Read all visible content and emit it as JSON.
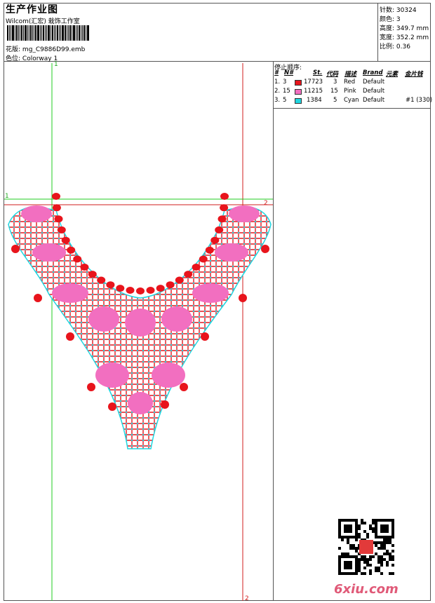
{
  "title": "生产作业图",
  "software": "Wilcom(汇宏) 栽饰工作室",
  "design": {
    "label": "花版:",
    "value": "mg_C9886D99.emb"
  },
  "colorway": {
    "label": "色位:",
    "value": "Colorway 1"
  },
  "stats": [
    {
      "label": "针数:",
      "value": "30324"
    },
    {
      "label": "颜色:",
      "value": "3"
    },
    {
      "label": "高度:",
      "value": "349.7 mm"
    },
    {
      "label": "宽度:",
      "value": "352.2 mm"
    },
    {
      "label": "比例:",
      "value": "0.36"
    }
  ],
  "stop_sequence": {
    "title": "停止顺序:",
    "headers": [
      "#",
      "N#",
      "St.",
      "代码",
      "描述",
      "Brand",
      "元素",
      "金片钱"
    ],
    "rows": [
      {
        "num": "1.",
        "needle": "3",
        "color": "#e8141c",
        "stitches": "17723",
        "code": "3",
        "desc": "Red",
        "brand": "Default",
        "element": ""
      },
      {
        "num": "2.",
        "needle": "15",
        "color": "#f26fc0",
        "stitches": "11215",
        "code": "15",
        "desc": "Pink",
        "brand": "Default",
        "element": ""
      },
      {
        "num": "3.",
        "needle": "5",
        "color": "#1fd6e0",
        "stitches": "1384",
        "code": "5",
        "desc": "Cyan",
        "brand": "Default",
        "element": "#1 (330)"
      }
    ]
  },
  "guides": {
    "v1": "1",
    "v2": "2",
    "h1": "1",
    "h2": "2",
    "v2b": "2"
  },
  "colors": {
    "red": "#e8141c",
    "pink": "#f26fc0",
    "cyan": "#1fd6e0",
    "green": "#22cc22",
    "guide_red": "#d21e1e"
  },
  "watermark": "6xiu.com"
}
